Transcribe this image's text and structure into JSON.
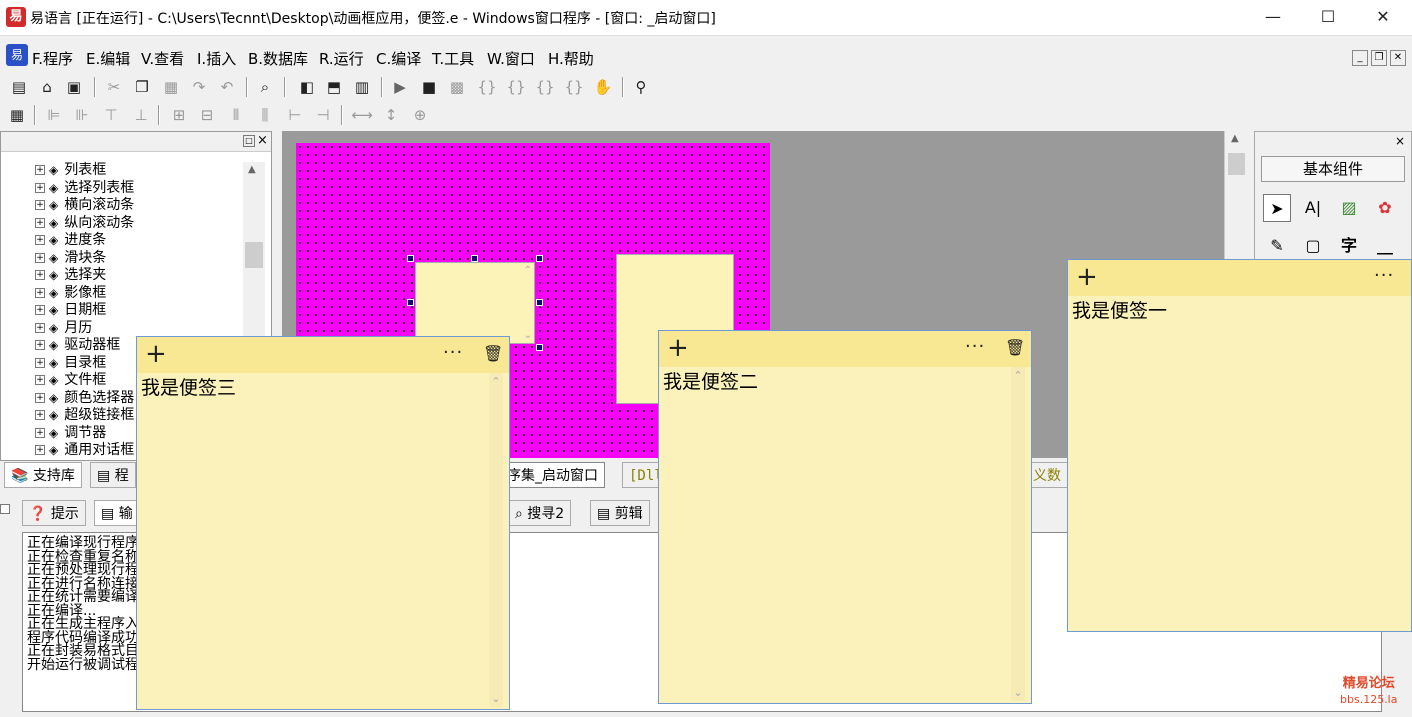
{
  "titlebar": {
    "icon_glyph": "易",
    "title": "易语言 [正在运行] - C:\\Users\\Tecnnt\\Desktop\\动画框应用，便签.e - Windows窗口程序 - [窗口: _启动窗口]",
    "minimize": "—",
    "maximize": "☐",
    "close": "✕"
  },
  "menubar": {
    "logo_glyph": "易",
    "items": [
      "F.程序",
      "E.编辑",
      "V.查看",
      "I.插入",
      "B.数据库",
      "R.运行",
      "C.编译",
      "T.工具",
      "W.窗口",
      "H.帮助"
    ],
    "mdi_min": "_",
    "mdi_restore": "❐",
    "mdi_close": "✕"
  },
  "left_panel": {
    "close": "×",
    "pin": "□",
    "tree_items": [
      "列表框",
      "选择列表框",
      "横向滚动条",
      "纵向滚动条",
      "进度条",
      "滑块条",
      "选择夹",
      "影像框",
      "日期框",
      "月历",
      "驱动器框",
      "目录框",
      "文件框",
      "颜色选择器",
      "超级链接框",
      "调节器",
      "通用对话框"
    ],
    "tabs": [
      "支持库",
      "程"
    ]
  },
  "designer_tabs": [
    "序集_启动窗口",
    "[Dll",
    "义数"
  ],
  "right_panel": {
    "header_close": "×",
    "basic_components": "基本组件",
    "components": [
      "pointer-icon",
      "label-icon",
      "image-icon",
      "shape-icon",
      "edit-icon",
      "text-icon",
      "char-icon",
      "line-icon"
    ],
    "char_glyph": "字"
  },
  "bottom_tabs": [
    "提示",
    "输",
    "搜寻2",
    "剪辑"
  ],
  "output_lines": [
    "正在编译现行程序",
    "正在检查重复名称",
    "正在预处理现行程序",
    "正在进行名称连接",
    "正在统计需要编译",
    "正在编译...",
    "正在生成主程序入口",
    "程序代码编译成功",
    "正在封装易格式目",
    "开始运行被调试程"
  ],
  "notes": [
    {
      "text": "我是便签三"
    },
    {
      "text": "我是便签二"
    },
    {
      "text": "我是便签一"
    }
  ],
  "note_glyphs": {
    "plus": "+",
    "dots": "···",
    "trash": "🗑"
  },
  "watermark": {
    "line1": "精易论坛",
    "line2": "bbs.125.la"
  },
  "colors": {
    "form_bg": "#f500f5",
    "note_bg": "#fbf1bb",
    "note_header": "#f8e894",
    "designer_bg": "#9a9a9a"
  }
}
